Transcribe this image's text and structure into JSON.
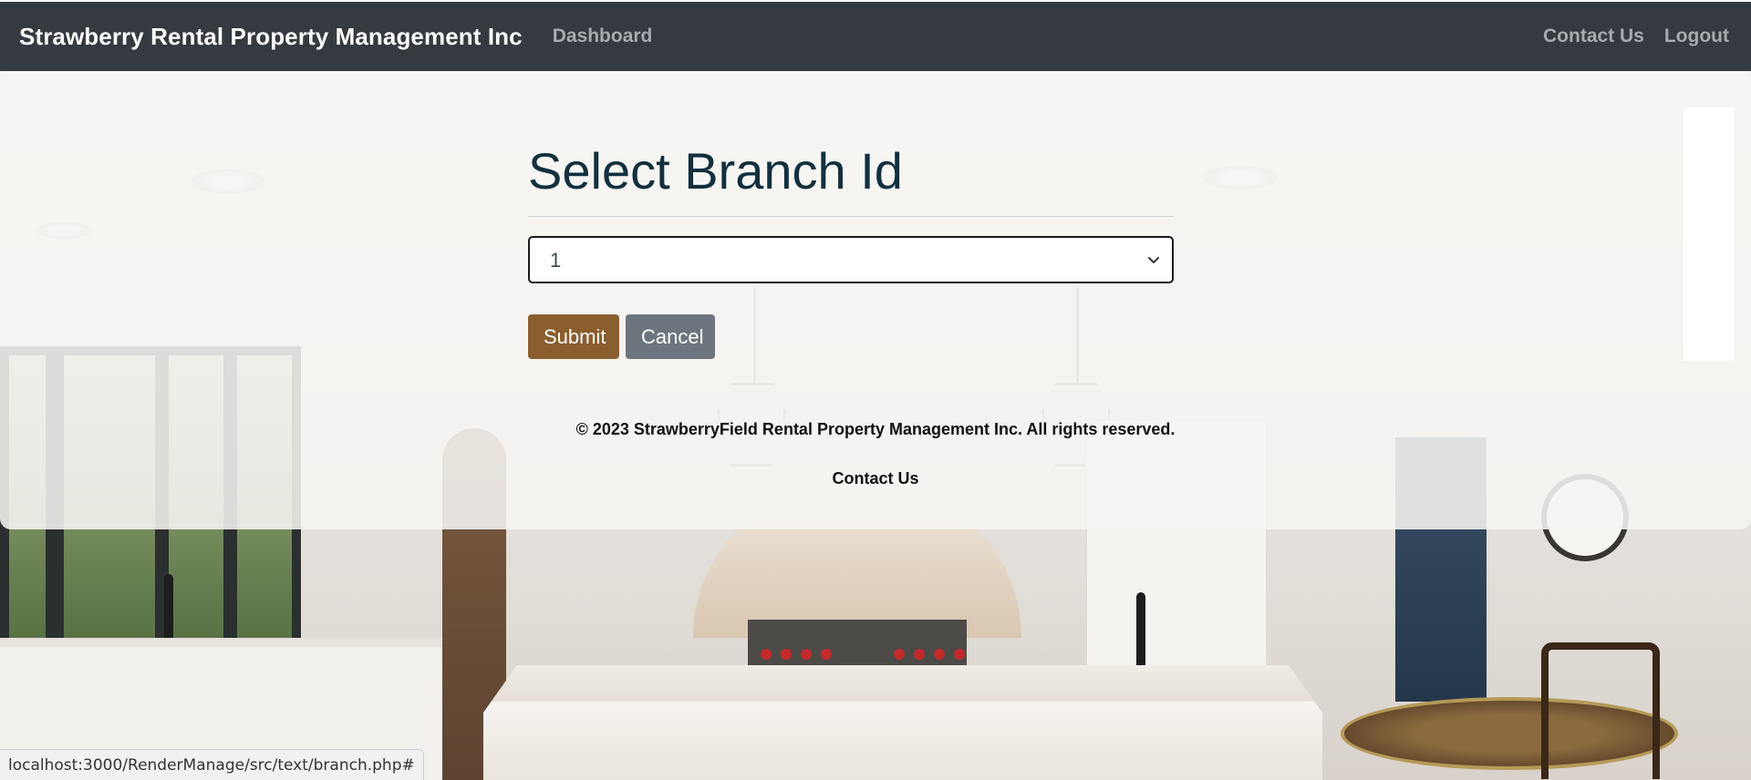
{
  "navbar": {
    "brand": "Strawberry Rental Property Management Inc",
    "links_left": [
      {
        "label": "Dashboard"
      }
    ],
    "links_right": [
      {
        "label": "Contact Us"
      },
      {
        "label": "Logout"
      }
    ]
  },
  "main": {
    "title": "Select Branch Id",
    "branch_select": {
      "selected_value": "1"
    },
    "submit_label": "Submit",
    "cancel_label": "Cancel"
  },
  "footer": {
    "copyright": "© 2023 StrawberryField Rental Property Management Inc. All rights reserved.",
    "contact_label": "Contact Us"
  },
  "status_bar": {
    "url": "localhost:3000/RenderManage/src/text/branch.php#"
  },
  "colors": {
    "navbar_bg": "#343a40",
    "submit_bg": "#8b5e2e",
    "cancel_bg": "#6c757d",
    "title_color": "#12303f"
  },
  "icons": {
    "select_arrow": "chevron-down-icon"
  }
}
